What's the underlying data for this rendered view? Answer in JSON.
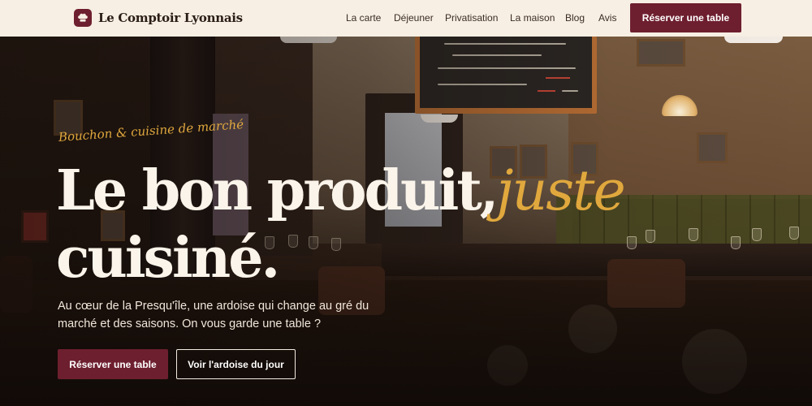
{
  "brand": {
    "name": "Le Comptoir Lyonnais",
    "icon": "chef-hat-icon"
  },
  "nav": {
    "items": [
      "La carte",
      "Déjeuner",
      "Privatisation",
      "La maison",
      "Blog",
      "Avis"
    ],
    "cta_label": "Réserver une table"
  },
  "hero": {
    "eyebrow": "Bouchon & cuisine de marché",
    "title_line1": "Le bon produit,",
    "title_accent": "juste",
    "title_line2": "cuisiné.",
    "lede": "Au cœur de la Presqu'île, une ardoise qui change au gré du marché et des saisons. On vous garde une table ?",
    "primary_button": "Réserver une table",
    "secondary_button": "Voir l'ardoise du jour"
  },
  "colors": {
    "brand": "#6e1f2f",
    "accent_gold": "#e0a83d",
    "header_bg": "#f7efe3",
    "hero_text": "#fbf4ea"
  }
}
